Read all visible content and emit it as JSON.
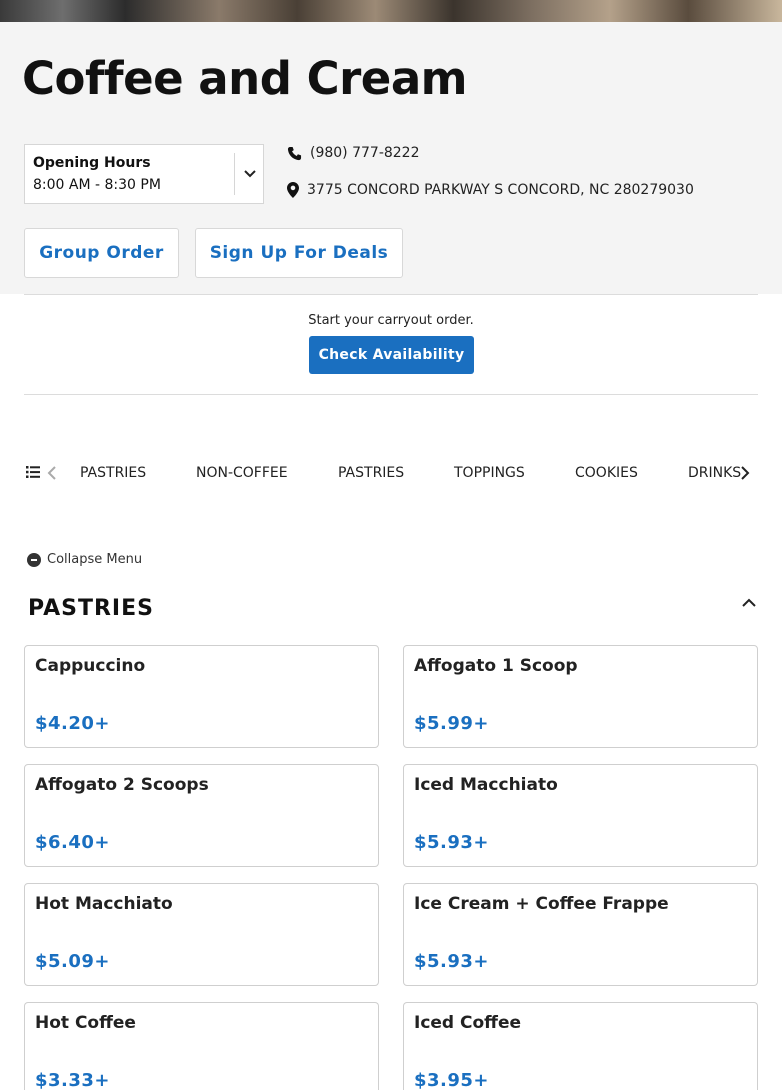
{
  "restaurant": {
    "name": "Coffee and Cream",
    "hours_label": "Opening Hours",
    "hours_value": "8:00 AM - 8:30 PM",
    "phone": "(980) 777-8222",
    "address": "3775 CONCORD PARKWAY S CONCORD, NC 280279030"
  },
  "actions": {
    "group_order": "Group Order",
    "sign_up_deals": "Sign Up For Deals",
    "carryout_prompt": "Start your carryout order.",
    "check_availability": "Check Availability"
  },
  "categories": [
    "PASTRIES",
    "NON-COFFEE",
    "PASTRIES",
    "TOPPINGS",
    "COOKIES",
    "DRINKS"
  ],
  "menu": {
    "collapse_label": "Collapse Menu",
    "section_title": "PASTRIES",
    "items": [
      {
        "name": "Cappuccino",
        "price": "$4.20+"
      },
      {
        "name": "Affogato 1 Scoop",
        "price": "$5.99+"
      },
      {
        "name": "Affogato 2 Scoops",
        "price": "$6.40+"
      },
      {
        "name": "Iced Macchiato",
        "price": "$5.93+"
      },
      {
        "name": "Hot Macchiato",
        "price": "$5.09+"
      },
      {
        "name": "Ice Cream + Coffee Frappe",
        "price": "$5.93+"
      },
      {
        "name": "Hot Coffee",
        "price": "$3.33+"
      },
      {
        "name": "Iced Coffee",
        "price": "$3.95+"
      }
    ]
  },
  "colors": {
    "accent": "#1a6fc0",
    "header_bg": "#f4f4f4"
  },
  "icons": [
    "phone-icon",
    "map-pin-icon",
    "chevron-down-icon",
    "list-icon",
    "chevron-left-icon",
    "chevron-right-icon",
    "minus-circle-icon",
    "chevron-up-icon"
  ]
}
